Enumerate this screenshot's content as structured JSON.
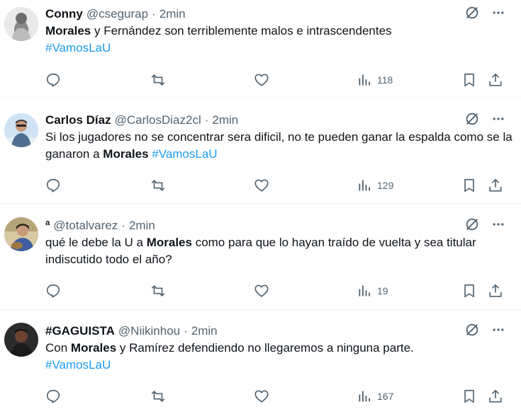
{
  "tweets": [
    {
      "name": "Conny",
      "handle": "@csegurap",
      "time": "2min",
      "text_segments": [
        {
          "text": "Morales",
          "style": "bold"
        },
        {
          "text": " y Fernández son terriblemente malos e intrascendentes",
          "style": "plain"
        },
        {
          "text": "\n",
          "style": "plain"
        },
        {
          "text": "#VamosLaU",
          "style": "tag"
        }
      ],
      "views": "118"
    },
    {
      "name": "Carlos Díaz",
      "handle": "@CarlosDiaz2cl",
      "time": "2min",
      "text_segments": [
        {
          "text": "Si los jugadores no se concentrar sera dificil, no te pueden ganar la espalda como se la ganaron a ",
          "style": "plain"
        },
        {
          "text": "Morales",
          "style": "bold"
        },
        {
          "text": "  ",
          "style": "plain"
        },
        {
          "text": "#VamosLaU",
          "style": "tag"
        }
      ],
      "views": "129"
    },
    {
      "name": "ª",
      "handle": "@totalvarez",
      "time": "2min",
      "text_segments": [
        {
          "text": "qué le debe la U a ",
          "style": "plain"
        },
        {
          "text": "Morales",
          "style": "bold"
        },
        {
          "text": " como para que lo hayan traído de vuelta y sea titular indiscutido todo el año?",
          "style": "plain"
        }
      ],
      "views": "19"
    },
    {
      "name": "#GAGUISTA",
      "handle": "@Niikinhou",
      "time": "2min",
      "text_segments": [
        {
          "text": "Con ",
          "style": "plain"
        },
        {
          "text": "Morales",
          "style": "bold"
        },
        {
          "text": " y Ramírez defendiendo no llegaremos a ninguna parte.",
          "style": "plain"
        },
        {
          "text": "\n",
          "style": "plain"
        },
        {
          "text": "#VamosLaU",
          "style": "tag"
        }
      ],
      "views": "167"
    }
  ],
  "meta": {
    "separator": "·"
  },
  "icons": {
    "grok": "grok-icon",
    "more": "more-options-icon",
    "reply": "reply-icon",
    "retweet": "retweet-icon",
    "like": "heart-icon",
    "views": "views-chart-icon",
    "bookmark": "bookmark-icon",
    "share": "share-icon"
  },
  "colors": {
    "text": "#0f1419",
    "secondary": "#536471",
    "hashtag": "#1d9bf0",
    "divider": "#eff3f4"
  }
}
